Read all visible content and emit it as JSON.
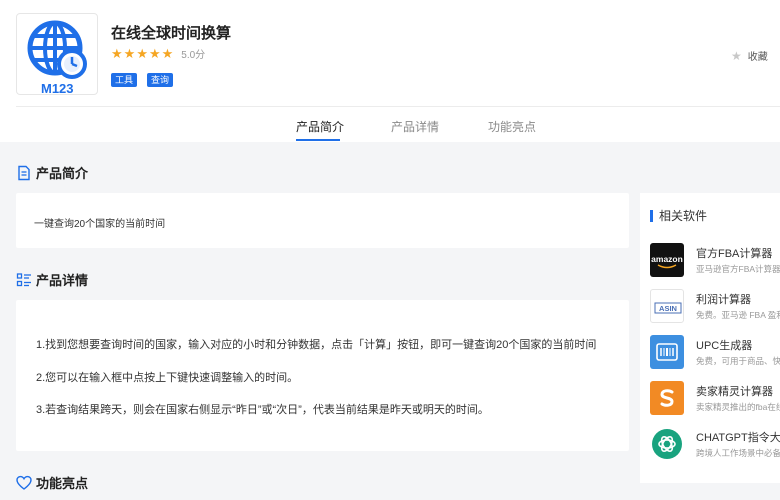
{
  "app": {
    "title": "在线全球时间换算",
    "rating": "5.0分",
    "stars": 5,
    "tags": [
      "工具",
      "查询"
    ],
    "logo_text": "M123",
    "favorite_label": "收藏"
  },
  "tabs": [
    {
      "label": "产品简介",
      "active": true
    },
    {
      "label": "产品详情",
      "active": false
    },
    {
      "label": "功能亮点",
      "active": false
    }
  ],
  "intro": {
    "heading": "产品简介",
    "text": "一键查询20个国家的当前时间"
  },
  "details": {
    "heading": "产品详情",
    "lines": [
      "1.找到您想要查询时间的国家，输入对应的小时和分钟数据，点击「计算」按钮，即可一键查询20个国家的当前时间",
      "2.您可以在输入框中点按上下键快速调整输入的时间。",
      "3.若查询结果跨天，则会在国家右侧显示“昨日”或“次日”，代表当前结果是昨天或明天的时间。"
    ]
  },
  "highlights": {
    "heading": "功能亮点"
  },
  "related": {
    "heading": "相关软件",
    "items": [
      {
        "name": "官方FBA计算器",
        "desc": "亚马逊官方FBA计算器",
        "icon": "amazon-icon",
        "icon_text": "amazon"
      },
      {
        "name": "利润计算器",
        "desc": "免费。亚马逊 FBA 盈利",
        "icon": "asin-icon",
        "icon_text": "ASIN"
      },
      {
        "name": "UPC生成器",
        "desc": "免费，可用于商品、快...",
        "icon": "barcode-icon",
        "icon_text": ""
      },
      {
        "name": "卖家精灵计算器",
        "desc": "卖家精灵推出的fba在线",
        "icon": "sellersprite-icon",
        "icon_text": ""
      },
      {
        "name": "CHATGPT指令大全",
        "desc": "跨境人工作场景中必备",
        "icon": "chatgpt-icon",
        "icon_text": ""
      }
    ]
  },
  "colors": {
    "accent": "#1f6fe8",
    "star": "#f5a623",
    "background": "#f4f5f7"
  }
}
